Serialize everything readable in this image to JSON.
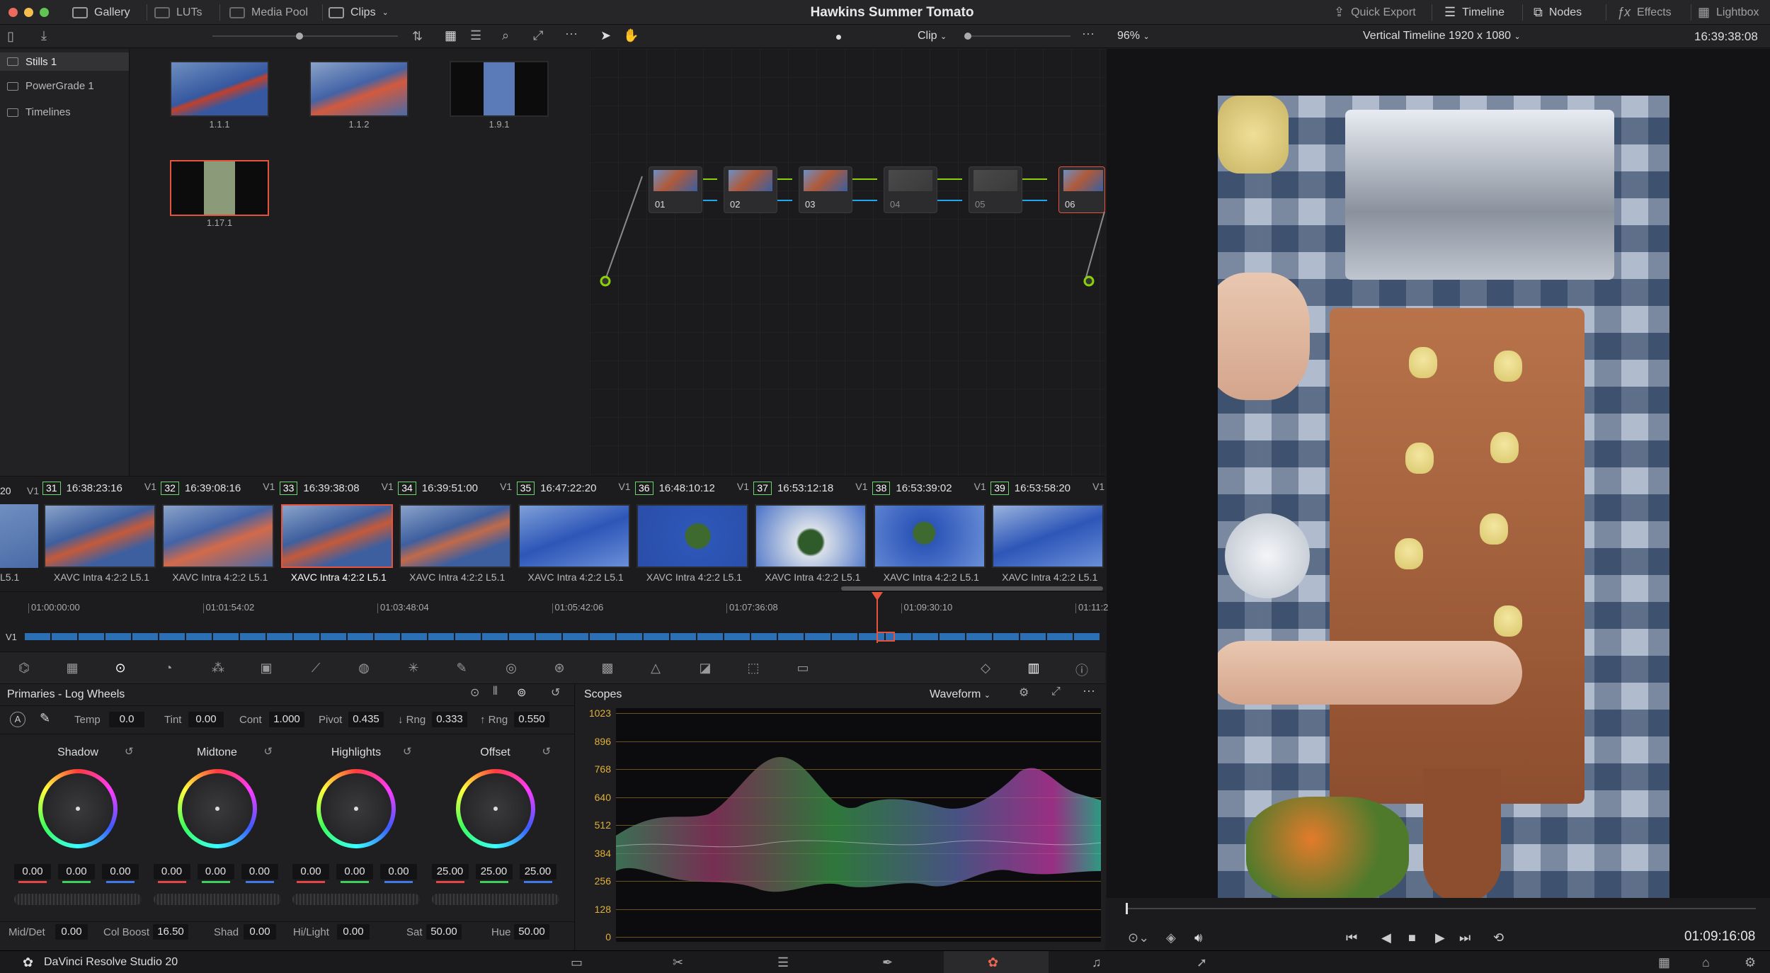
{
  "topbar": {
    "gallery": "Gallery",
    "luts": "LUTs",
    "media_pool": "Media Pool",
    "clips": "Clips",
    "project_title": "Hawkins Summer Tomato",
    "quick_export": "Quick Export",
    "timeline": "Timeline",
    "nodes": "Nodes",
    "effects": "Effects",
    "lightbox": "Lightbox"
  },
  "toolbar2": {
    "clip_mode": "Clip",
    "zoom": "96%",
    "timeline_name": "Vertical Timeline 1920 x 1080",
    "timecode": "16:39:38:08"
  },
  "gallery": {
    "albums": [
      "Stills 1",
      "PowerGrade 1",
      "Timelines"
    ],
    "stills": [
      "1.1.1",
      "1.1.2",
      "1.9.1",
      "1.17.1"
    ]
  },
  "nodes": [
    "01",
    "02",
    "03",
    "04",
    "05",
    "06"
  ],
  "clips": [
    {
      "num": "31",
      "tc": "16:38:23:16",
      "track": "V1",
      "codec": "XAVC Intra 4:2:2 L5.1"
    },
    {
      "num": "32",
      "tc": "16:39:08:16",
      "track": "V1",
      "codec": "XAVC Intra 4:2:2 L5.1"
    },
    {
      "num": "33",
      "tc": "16:39:38:08",
      "track": "V1",
      "codec": "XAVC Intra 4:2:2 L5.1"
    },
    {
      "num": "34",
      "tc": "16:39:51:00",
      "track": "V1",
      "codec": "XAVC Intra 4:2:2 L5.1"
    },
    {
      "num": "35",
      "tc": "16:47:22:20",
      "track": "V1",
      "codec": "XAVC Intra 4:2:2 L5.1"
    },
    {
      "num": "36",
      "tc": "16:48:10:12",
      "track": "V1",
      "codec": "XAVC Intra 4:2:2 L5.1"
    },
    {
      "num": "37",
      "tc": "16:53:12:18",
      "track": "V1",
      "codec": "XAVC Intra 4:2:2 L5.1"
    },
    {
      "num": "38",
      "tc": "16:53:39:02",
      "track": "V1",
      "codec": "XAVC Intra 4:2:2 L5.1"
    },
    {
      "num": "39",
      "tc": "16:53:58:20",
      "track": "V1",
      "codec": "XAVC Intra 4:2:2 L5.1"
    }
  ],
  "clip_partial": {
    "num": "20",
    "track": "V1",
    "codec": "L5.1"
  },
  "minitimeline": {
    "ticks": [
      "01:00:00:00",
      "01:01:54:02",
      "01:03:48:04",
      "01:05:42:06",
      "01:07:36:08",
      "01:09:30:10",
      "01:11:2"
    ],
    "track": "V1"
  },
  "primaries": {
    "title": "Primaries - Log Wheels",
    "temp_label": "Temp",
    "temp": "0.0",
    "tint_label": "Tint",
    "tint": "0.00",
    "cont_label": "Cont",
    "cont": "1.000",
    "pivot_label": "Pivot",
    "pivot": "0.435",
    "lrng_label": "↓ Rng",
    "lrng": "0.333",
    "hrng_label": "↑ Rng",
    "hrng": "0.550",
    "wheels": [
      {
        "name": "Shadow",
        "vals": [
          "0.00",
          "0.00",
          "0.00"
        ]
      },
      {
        "name": "Midtone",
        "vals": [
          "0.00",
          "0.00",
          "0.00"
        ]
      },
      {
        "name": "Highlights",
        "vals": [
          "0.00",
          "0.00",
          "0.00"
        ]
      },
      {
        "name": "Offset",
        "vals": [
          "25.00",
          "25.00",
          "25.00"
        ]
      }
    ],
    "middet_label": "Mid/Det",
    "middet": "0.00",
    "colboost_label": "Col Boost",
    "colboost": "16.50",
    "shad_label": "Shad",
    "shad": "0.00",
    "hilight_label": "Hi/Light",
    "hilight": "0.00",
    "sat_label": "Sat",
    "sat": "50.00",
    "hue_label": "Hue",
    "hue": "50.00"
  },
  "scopes": {
    "title": "Scopes",
    "mode": "Waveform",
    "scale": [
      "1023",
      "896",
      "768",
      "640",
      "512",
      "384",
      "256",
      "128",
      "0"
    ]
  },
  "transport": {
    "timecode": "01:09:16:08"
  },
  "bottom": {
    "app_name": "DaVinci Resolve Studio 20"
  },
  "colors": {
    "accent_red": "#e6533c",
    "node_green": "#8ad10a",
    "link_blue": "#1fa6f0",
    "scope_amber": "#e0b03a"
  }
}
